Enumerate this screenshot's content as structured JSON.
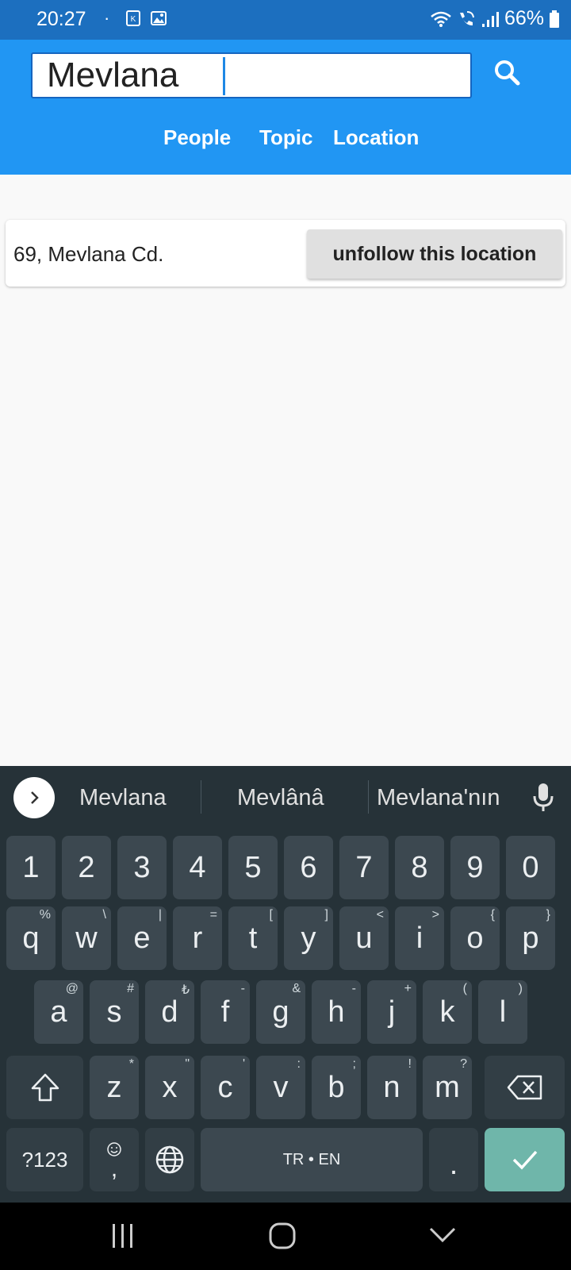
{
  "status_bar": {
    "time": "20:27",
    "battery": "66%",
    "icons": [
      "dot-icon",
      "app-k-icon",
      "image-icon",
      "wifi-icon",
      "wifi-call-icon",
      "signal-icon",
      "battery-icon"
    ]
  },
  "search": {
    "value": "Mevlana",
    "icon": "search-icon"
  },
  "tabs": [
    {
      "label": "People"
    },
    {
      "label": "Topic"
    },
    {
      "label": "Location"
    }
  ],
  "results": [
    {
      "label": "69, Mevlana Cd.",
      "button": "unfollow this location"
    }
  ],
  "keyboard": {
    "suggestions": [
      "Mevlana",
      "Mevlânâ",
      "Mevlana'nın"
    ],
    "number_row": [
      "1",
      "2",
      "3",
      "4",
      "5",
      "6",
      "7",
      "8",
      "9",
      "0"
    ],
    "row1": [
      {
        "key": "q",
        "sup": "%"
      },
      {
        "key": "w",
        "sup": "\\"
      },
      {
        "key": "e",
        "sup": "|"
      },
      {
        "key": "r",
        "sup": "="
      },
      {
        "key": "t",
        "sup": "["
      },
      {
        "key": "y",
        "sup": "]"
      },
      {
        "key": "u",
        "sup": "<"
      },
      {
        "key": "i",
        "sup": ">"
      },
      {
        "key": "o",
        "sup": "{"
      },
      {
        "key": "p",
        "sup": "}"
      }
    ],
    "row2": [
      {
        "key": "a",
        "sup": "@"
      },
      {
        "key": "s",
        "sup": "#"
      },
      {
        "key": "d",
        "sup": "₺"
      },
      {
        "key": "f",
        "sup": "-"
      },
      {
        "key": "g",
        "sup": "&"
      },
      {
        "key": "h",
        "sup": "-"
      },
      {
        "key": "j",
        "sup": "+"
      },
      {
        "key": "k",
        "sup": "("
      },
      {
        "key": "l",
        "sup": ")"
      }
    ],
    "row3": [
      {
        "key": "z",
        "sup": "*"
      },
      {
        "key": "x",
        "sup": "\""
      },
      {
        "key": "c",
        "sup": "'"
      },
      {
        "key": "v",
        "sup": ":"
      },
      {
        "key": "b",
        "sup": ";"
      },
      {
        "key": "n",
        "sup": "!"
      },
      {
        "key": "m",
        "sup": "?"
      }
    ],
    "symbols_label": "?123",
    "comma": ",",
    "space_label": "TR • EN",
    "period": "."
  },
  "colors": {
    "status_bar": "#1c6fbf",
    "header": "#2196f3",
    "keyboard_bg": "#263238",
    "key": "#3c4850",
    "enter_key": "#6fb6aa"
  }
}
